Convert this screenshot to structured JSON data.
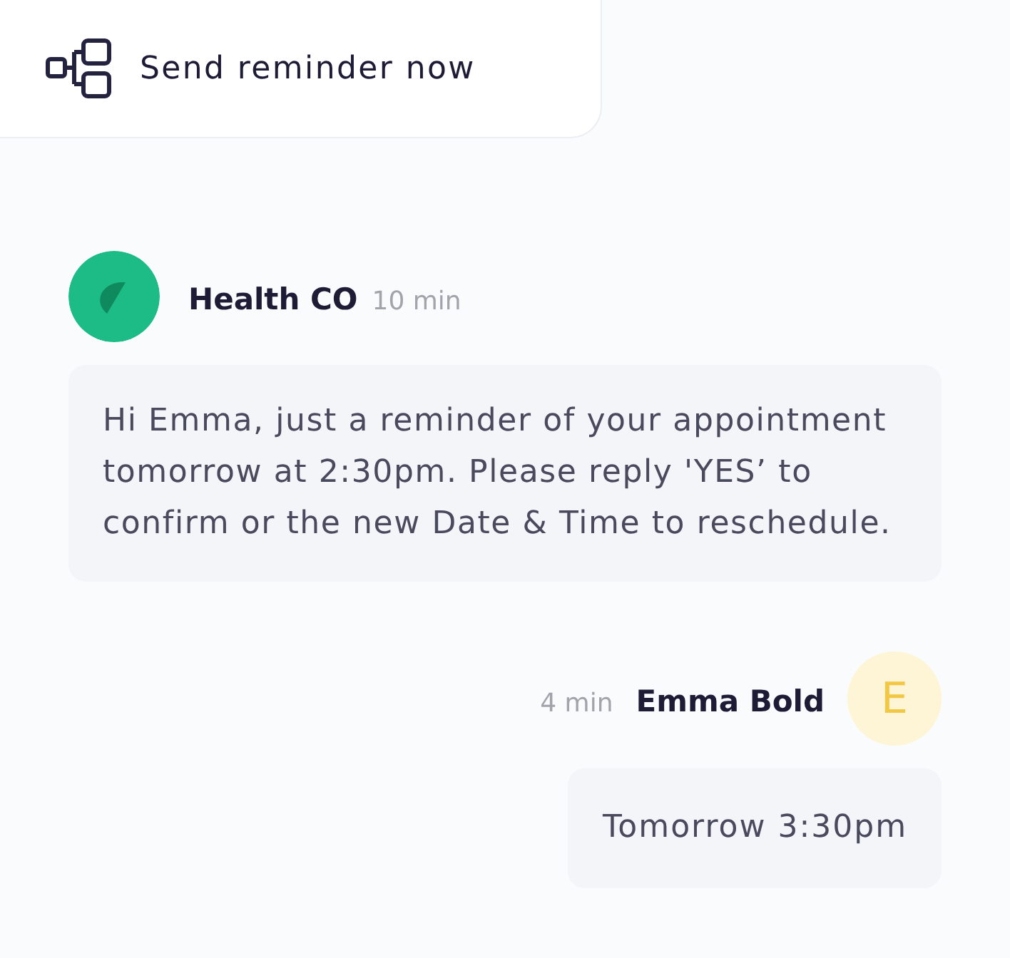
{
  "reminder_button": {
    "label": "Send reminder now"
  },
  "messages": [
    {
      "kind": "incoming",
      "sender": "Health CO",
      "time": "10 min",
      "avatar": {
        "color": "#1dbb86"
      },
      "text": "Hi Emma, just a reminder of your appointment tomorrow at 2:30pm. Please reply 'YES’ to confirm or the new Date & Time to reschedule."
    },
    {
      "kind": "outgoing",
      "sender": "Emma Bold",
      "time": "4 min",
      "avatar": {
        "color": "#fdf5d6",
        "initial": "E"
      },
      "text": "Tomorrow 3:30pm"
    }
  ]
}
